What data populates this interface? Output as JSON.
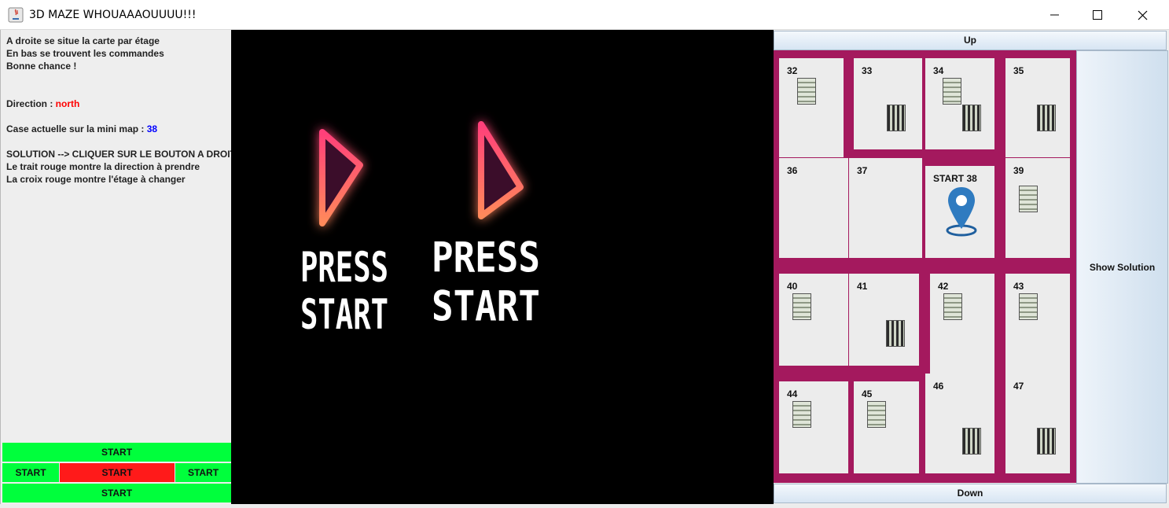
{
  "window": {
    "title": "3D MAZE WHOUAAAOUUUU!!!",
    "minimize_icon": "minimize-icon",
    "maximize_icon": "maximize-icon",
    "close_icon": "close-icon"
  },
  "info": {
    "line1": "A droite se situe la carte par étage",
    "line2": "En bas se trouvent les commandes",
    "line3": "Bonne chance !",
    "direction_label": "Direction : ",
    "direction_value": "north",
    "case_label": "Case actuelle sur la mini map : ",
    "case_value": "38",
    "solution_line": "SOLUTION --> CLIQUER SUR LE BOUTON A DROITE",
    "hint1": "Le trait rouge montre la direction à prendre",
    "hint2": "La croix rouge montre l'étage à changer"
  },
  "controls": {
    "top": "START",
    "left": "START",
    "center": "START",
    "right": "START",
    "bottom": "START"
  },
  "view": {
    "text1_line1": "PRESS",
    "text1_line2": "START",
    "text2_line1": "PRESS",
    "text2_line2": "START"
  },
  "map": {
    "up_label": "Up",
    "down_label": "Down",
    "show_solution_label": "Show Solution",
    "cells": [
      "32",
      "33",
      "34",
      "35",
      "36",
      "37",
      "START 38",
      "39",
      "40",
      "41",
      "42",
      "43",
      "44",
      "45",
      "46",
      "47"
    ]
  },
  "colors": {
    "grid": "#a4195e",
    "control_green": "#00ff3c",
    "control_red": "#ff1a1a",
    "direction": "#ff0000",
    "case": "#0000ff",
    "pin": "#2f7bc0"
  }
}
